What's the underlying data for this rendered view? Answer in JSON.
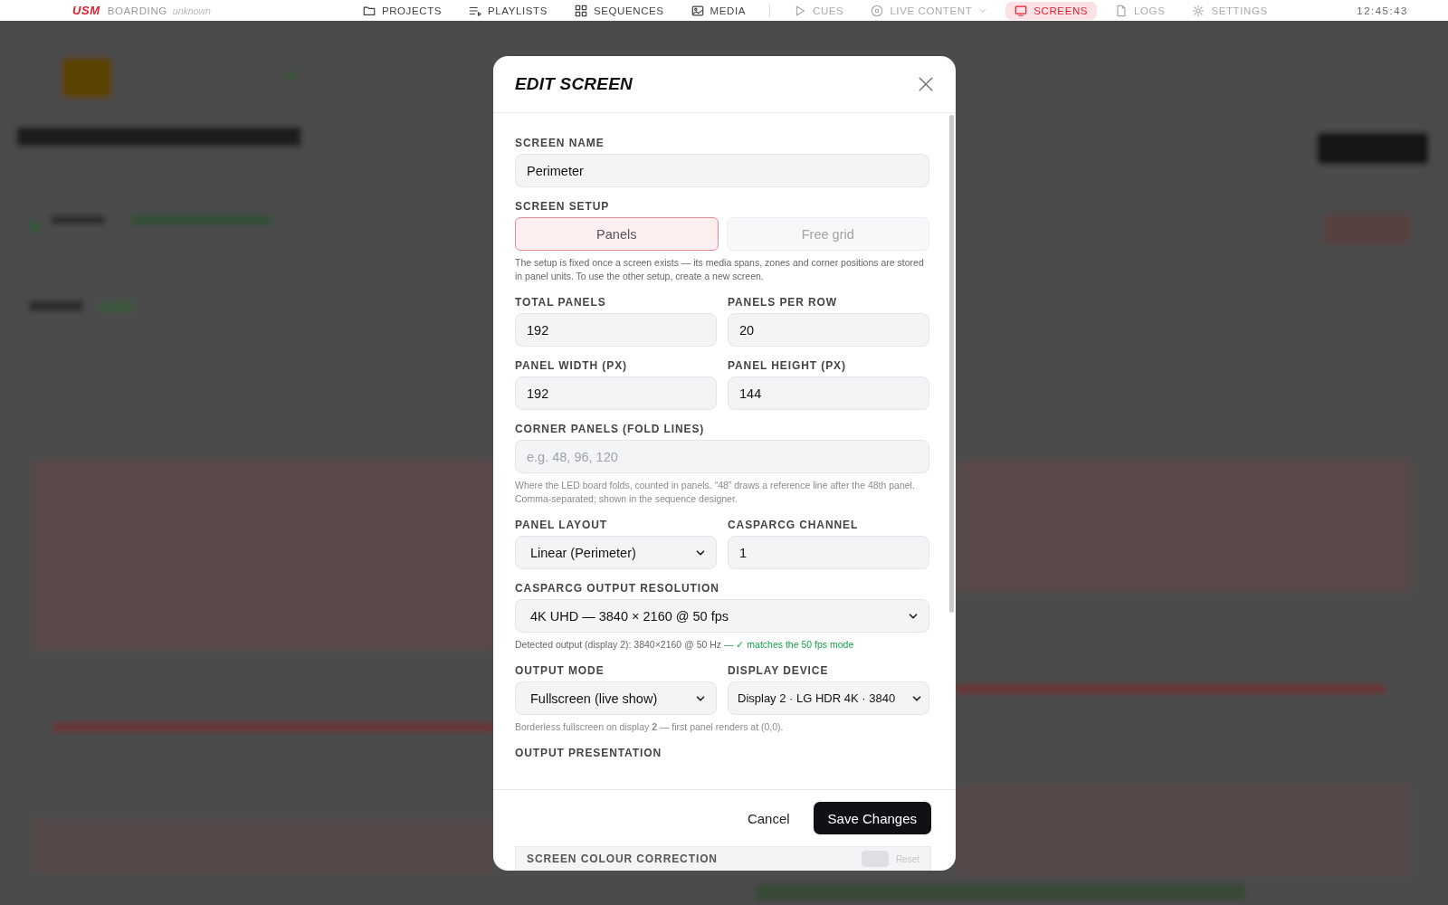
{
  "nav": {
    "logo": "USM",
    "section": "BOARDING",
    "status": "unknown",
    "clock": "12:45:43",
    "items": [
      {
        "label": "PROJECTS",
        "selected": false,
        "disabled": false
      },
      {
        "label": "PLAYLISTS",
        "selected": false,
        "disabled": false
      },
      {
        "label": "SEQUENCES",
        "selected": false,
        "disabled": false
      },
      {
        "label": "MEDIA",
        "selected": false,
        "disabled": false
      },
      {
        "label": "CUES",
        "selected": false,
        "disabled": true
      },
      {
        "label": "LIVE CONTENT",
        "selected": false,
        "disabled": true
      },
      {
        "label": "SCREENS",
        "selected": true,
        "disabled": false
      },
      {
        "label": "LOGS",
        "selected": false,
        "disabled": true
      },
      {
        "label": "SETTINGS",
        "selected": false,
        "disabled": true
      }
    ]
  },
  "dialog": {
    "title": "EDIT SCREEN",
    "sections": [
      {
        "kind": "field",
        "label": "SCREEN NAME",
        "value": "Perimeter"
      },
      {
        "kind": "segmented",
        "label": "SCREEN SETUP",
        "options": [
          {
            "label": "Panels",
            "selected": true
          },
          {
            "label": "Free grid",
            "selected": false
          }
        ],
        "help": "The setup is fixed once a screen exists — its media spans, zones and corner positions are stored in panel units. To use the other setup, create a new screen."
      },
      {
        "kind": "pair",
        "fields": [
          {
            "kind": "field",
            "label": "TOTAL PANELS",
            "value": "192"
          },
          {
            "kind": "field",
            "label": "PANELS PER ROW",
            "value": "20"
          }
        ]
      },
      {
        "kind": "pair",
        "fields": [
          {
            "kind": "field",
            "label": "PANEL WIDTH (PX)",
            "value": "192"
          },
          {
            "kind": "field",
            "label": "PANEL HEIGHT (PX)",
            "value": "144"
          }
        ]
      },
      {
        "kind": "field",
        "label": "CORNER PANELS (FOLD LINES)",
        "placeholder": "e.g. 48, 96, 120",
        "help": "Where the LED board folds, counted in panels. “48” draws a reference line after the 48th panel. Comma-separated; shown in the sequence designer."
      },
      {
        "kind": "pair",
        "fields": [
          {
            "kind": "select",
            "label": "PANEL LAYOUT",
            "value": "Linear (Perimeter)"
          },
          {
            "kind": "field",
            "label": "CASPARCG CHANNEL",
            "value": "1"
          }
        ]
      },
      {
        "kind": "select",
        "label": "CASPARCG OUTPUT RESOLUTION",
        "value": "4K UHD — 3840 × 2160 @ 50 fps",
        "help": "Detected output (display 2): 3840×2160 @ 50 Hz",
        "ok": "— ✓ matches the 50 fps mode"
      },
      {
        "kind": "pair",
        "fields": [
          {
            "kind": "select",
            "label": "OUTPUT MODE",
            "value": "Fullscreen (live show)"
          },
          {
            "kind": "select",
            "label": "DISPLAY DEVICE",
            "value": "Display 2 · LG HDR 4K · 3840"
          }
        ],
        "help": "Borderless fullscreen on display **2** — first panel renders at (0,0)."
      },
      {
        "kind": "heading",
        "label": "OUTPUT PRESENTATION"
      }
    ],
    "cancel": "Cancel",
    "save": "Save Changes",
    "colour_correction": {
      "title": "SCREEN COLOUR CORRECTION",
      "on": false,
      "reset": "Reset"
    }
  }
}
